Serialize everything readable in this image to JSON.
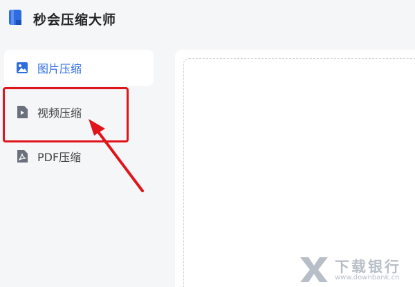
{
  "app": {
    "title": "秒会压缩大师"
  },
  "sidebar": {
    "items": [
      {
        "label": "图片压缩",
        "icon": "image-icon",
        "active": true
      },
      {
        "label": "视频压缩",
        "icon": "video-file-icon",
        "active": false
      },
      {
        "label": "PDF压缩",
        "icon": "pdf-file-icon",
        "active": false
      }
    ]
  },
  "annotation": {
    "highlight_color": "#e0151b",
    "target": "视频压缩"
  },
  "watermark": {
    "main": "下载银行",
    "sub": "www.downbank.cn"
  },
  "colors": {
    "accent": "#2d6de0",
    "background": "#f5f6f8",
    "panel": "#ffffff"
  }
}
